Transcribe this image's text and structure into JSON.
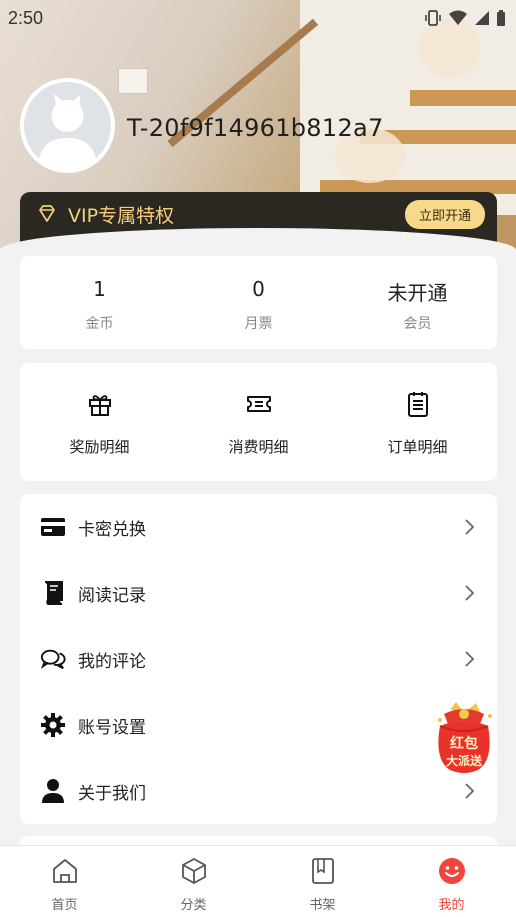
{
  "status_bar": {
    "time": "2:50"
  },
  "profile": {
    "username": "T-20f9f14961b812a7"
  },
  "vip": {
    "label": "VIP专属特权",
    "button": "立即开通"
  },
  "stats": [
    {
      "value": "1",
      "label": "金币"
    },
    {
      "value": "0",
      "label": "月票"
    },
    {
      "value": "未开通",
      "label": "会员"
    }
  ],
  "shortcuts": [
    {
      "label": "奖励明细",
      "icon": "gift-icon"
    },
    {
      "label": "消费明细",
      "icon": "ticket-icon"
    },
    {
      "label": "订单明细",
      "icon": "order-list-icon"
    }
  ],
  "menu": [
    {
      "label": "卡密兑换",
      "icon": "card-icon"
    },
    {
      "label": "阅读记录",
      "icon": "book-icon"
    },
    {
      "label": "我的评论",
      "icon": "comment-icon"
    },
    {
      "label": "账号设置",
      "icon": "gear-icon"
    },
    {
      "label": "关于我们",
      "icon": "user-icon"
    }
  ],
  "red_packet": {
    "line1": "红包",
    "line2": "大派送"
  },
  "bottom_nav": [
    {
      "label": "首页",
      "icon": "home-icon"
    },
    {
      "label": "分类",
      "icon": "category-cube-icon"
    },
    {
      "label": "书架",
      "icon": "bookshelf-icon"
    },
    {
      "label": "我的",
      "icon": "smiley-icon",
      "active": true
    }
  ],
  "colors": {
    "accent": "#f0443e",
    "vip_gold": "#f5cf7f",
    "vip_bg": "#2b2822"
  }
}
